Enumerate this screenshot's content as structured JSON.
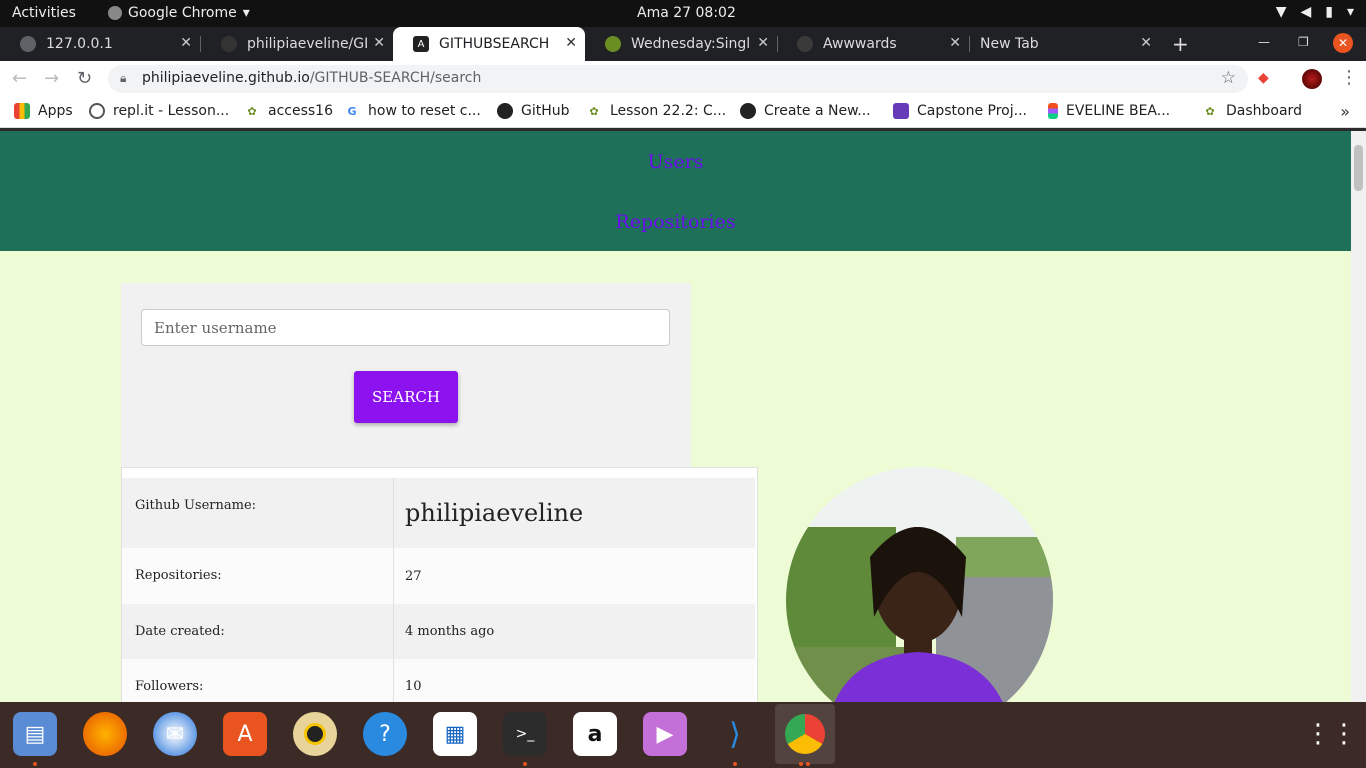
{
  "topbar": {
    "activities": "Activities",
    "app_name": "Google Chrome",
    "clock": "Ama 27  08:02"
  },
  "tabs": [
    {
      "label": "127.0.0.1",
      "active": false
    },
    {
      "label": "philipiaeveline/GIT",
      "active": false
    },
    {
      "label": "GITHUBSEARCH",
      "active": true
    },
    {
      "label": "Wednesday:Single",
      "active": false
    },
    {
      "label": "Awwwards",
      "active": false
    },
    {
      "label": "New Tab",
      "active": false
    }
  ],
  "omnibox": {
    "domain": "philipiaeveline.github.io",
    "path": "/GITHUB-SEARCH/search"
  },
  "bookmarks": [
    {
      "label": "Apps",
      "icon": "apps-grid-icon"
    },
    {
      "label": "repl.it - Lesson...",
      "icon": "replit-icon"
    },
    {
      "label": "access16",
      "icon": "moringa-icon"
    },
    {
      "label": "how to reset c...",
      "icon": "google-icon"
    },
    {
      "label": "GitHub",
      "icon": "github-icon"
    },
    {
      "label": "Lesson 22.2: C...",
      "icon": "moringa-icon"
    },
    {
      "label": "Create a New...",
      "icon": "github-icon"
    },
    {
      "label": "Capstone Proj...",
      "icon": "forms-icon"
    },
    {
      "label": "EVELINE BEA...",
      "icon": "figma-icon"
    },
    {
      "label": "Dashboard",
      "icon": "moringa-icon"
    }
  ],
  "page": {
    "nav": {
      "users": "Users",
      "repositories": "Repositories"
    },
    "search": {
      "placeholder": "Enter username",
      "button": "SEARCH"
    },
    "profile_rows": [
      {
        "key": "Github Username:",
        "value": "philipiaeveline"
      },
      {
        "key": "Repositories:",
        "value": "27"
      },
      {
        "key": "Date created:",
        "value": "4 months ago"
      },
      {
        "key": "Followers:",
        "value": "10"
      }
    ]
  },
  "dock": [
    "files-icon",
    "firefox-icon",
    "thunderbird-icon",
    "software-center-icon",
    "rhythmbox-icon",
    "help-icon",
    "libreoffice-impress-icon",
    "terminal-icon",
    "amazon-icon",
    "videos-icon",
    "vscode-icon",
    "chrome-icon",
    "show-apps-icon"
  ],
  "colors": {
    "nav_bg": "#1f7059",
    "nav_link": "#6c0df0",
    "page_bg": "#eefcd5",
    "button_bg": "#8c12ef"
  }
}
